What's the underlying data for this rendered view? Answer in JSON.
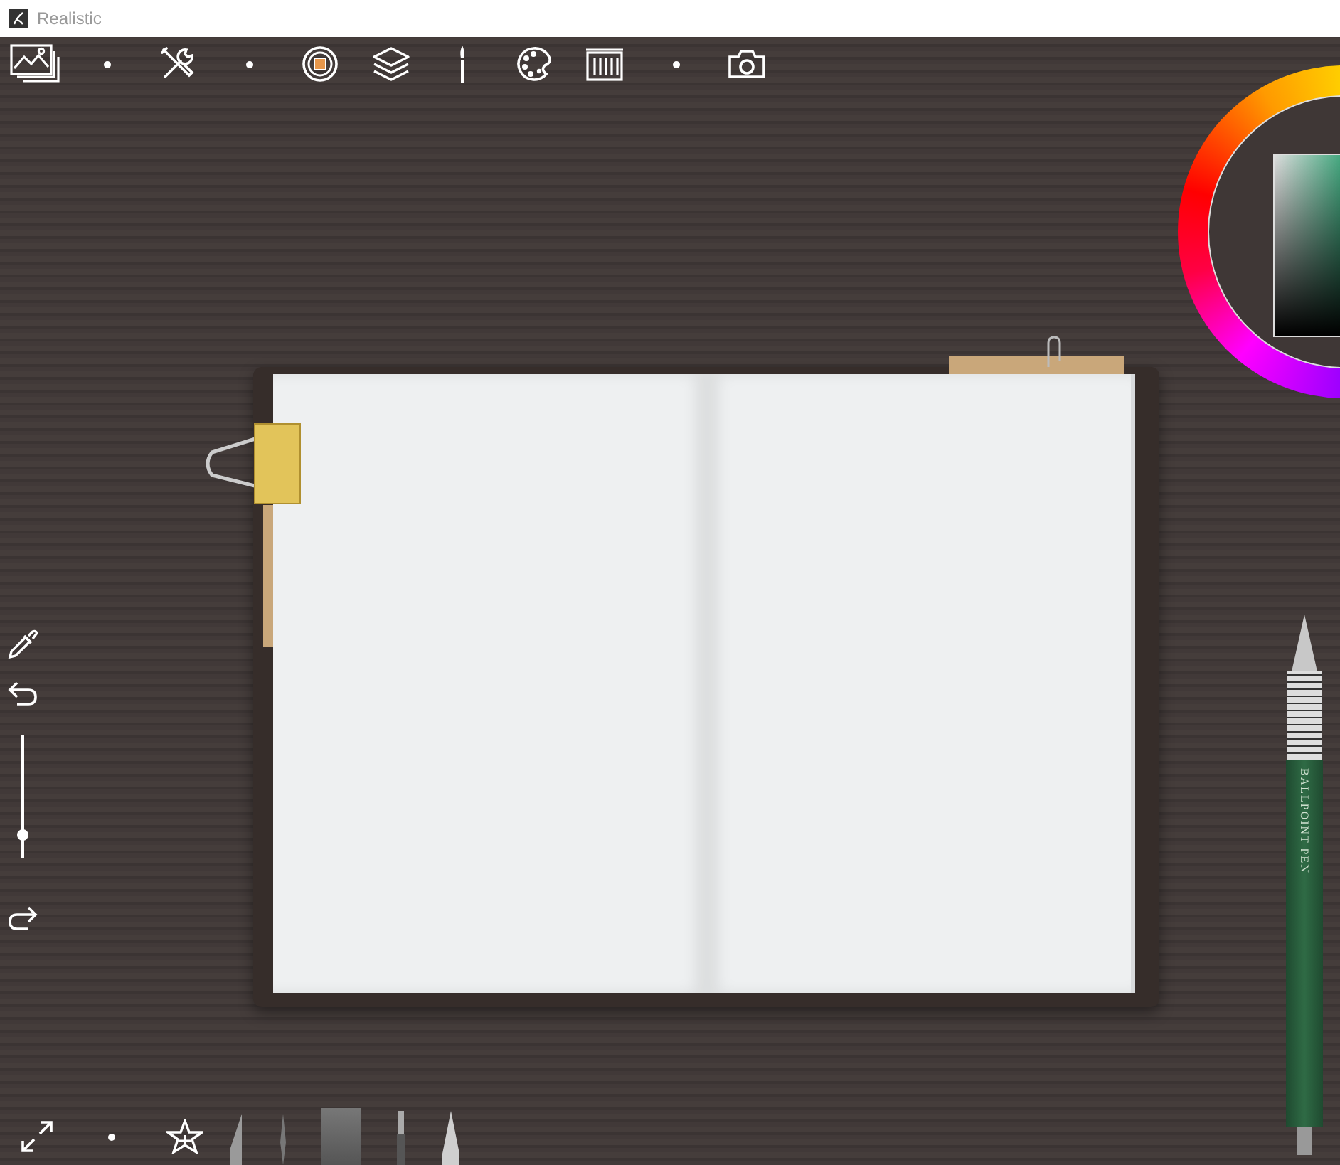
{
  "window": {
    "title": "Realistic"
  },
  "side_toolbar": {
    "size_slider": {
      "level": 0.19
    }
  },
  "pen": {
    "label": "BALLPOINT PEN"
  }
}
